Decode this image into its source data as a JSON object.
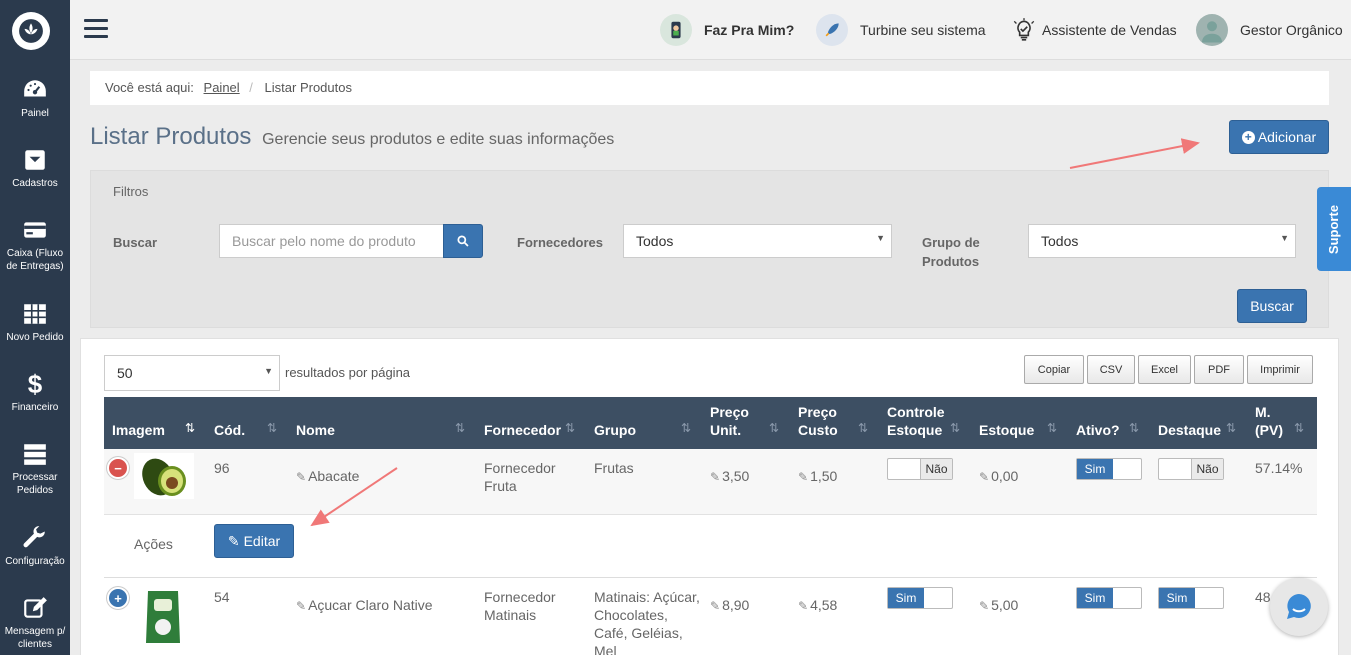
{
  "sidebar": {
    "items": [
      {
        "label": "Painel",
        "icon": "dashboard-icon"
      },
      {
        "label": "Cadastros",
        "icon": "inbox-icon"
      },
      {
        "label": "Caixa (Fluxo de Entregas)",
        "icon": "credit-card-icon"
      },
      {
        "label": "Novo Pedido",
        "icon": "grid-icon"
      },
      {
        "label": "Financeiro",
        "icon": "dollar-icon"
      },
      {
        "label": "Processar Pedidos",
        "icon": "server-icon"
      },
      {
        "label": "Configuração",
        "icon": "wrench-icon"
      },
      {
        "label": "Mensagem p/ clientes",
        "icon": "compose-icon"
      }
    ]
  },
  "topbar": {
    "faz_pra_mim": "Faz Pra Mim?",
    "turbine": "Turbine seu sistema",
    "assistente": "Assistente de Vendas",
    "user": "Gestor Orgânico"
  },
  "breadcrumb": {
    "prefix": "Você está aqui:",
    "home": "Painel",
    "separator": "/",
    "current": "Listar Produtos"
  },
  "page": {
    "title": "Listar Produtos",
    "subtitle": "Gerencie seus produtos e edite suas informações",
    "add_label": "Adicionar"
  },
  "filters": {
    "title": "Filtros",
    "search_label": "Buscar",
    "search_placeholder": "Buscar pelo nome do produto",
    "fornecedores_label": "Fornecedores",
    "fornecedores_value": "Todos",
    "grupo_label_1": "Grupo de",
    "grupo_label_2": "Produtos",
    "grupo_value": "Todos",
    "buscar_button": "Buscar"
  },
  "table": {
    "per_page_value": "50",
    "per_page_label": "resultados por página",
    "export_buttons": [
      "Copiar",
      "CSV",
      "Excel",
      "PDF",
      "Imprimir"
    ],
    "headers": {
      "imagem": "Imagem",
      "cod": "Cód.",
      "nome": "Nome",
      "fornecedor": "Fornecedor",
      "grupo": "Grupo",
      "preco_unit_1": "Preço",
      "preco_unit_2": "Unit.",
      "preco_custo_1": "Preço",
      "preco_custo_2": "Custo",
      "controle_1": "Controle",
      "controle_2": "Estoque",
      "estoque": "Estoque",
      "ativo": "Ativo?",
      "destaque": "Destaque",
      "margem_1": "M.",
      "margem_2": "(PV)"
    },
    "rows": [
      {
        "cod": "96",
        "nome": "Abacate",
        "fornecedor_1": "Fornecedor",
        "fornecedor_2": "Fruta",
        "grupo": "Frutas",
        "preco_unit": "3,50",
        "preco_custo": "1,50",
        "controle": "Não",
        "estoque": "0,00",
        "ativo": "Sim",
        "destaque": "Não",
        "margem": "57.14%"
      },
      {
        "cod": "54",
        "nome": "Açucar Claro Native",
        "fornecedor_1": "Fornecedor",
        "fornecedor_2": "Matinais",
        "grupo_lines": [
          "Matinais: Açúcar,",
          "Chocolates,",
          "Café, Geléias,",
          "Mel"
        ],
        "preco_unit": "8,90",
        "preco_custo": "4,58",
        "controle": "Sim",
        "estoque": "5,00",
        "ativo": "Sim",
        "destaque": "Sim",
        "margem": "48"
      }
    ],
    "acoes_label": "Ações",
    "editar_label": "Editar"
  },
  "support": {
    "label": "Suporte"
  },
  "colors": {
    "sidebar": "#2b3a4d",
    "primary": "#3a74b0",
    "table_header": "#3d4f63",
    "arrow": "#f07878"
  }
}
